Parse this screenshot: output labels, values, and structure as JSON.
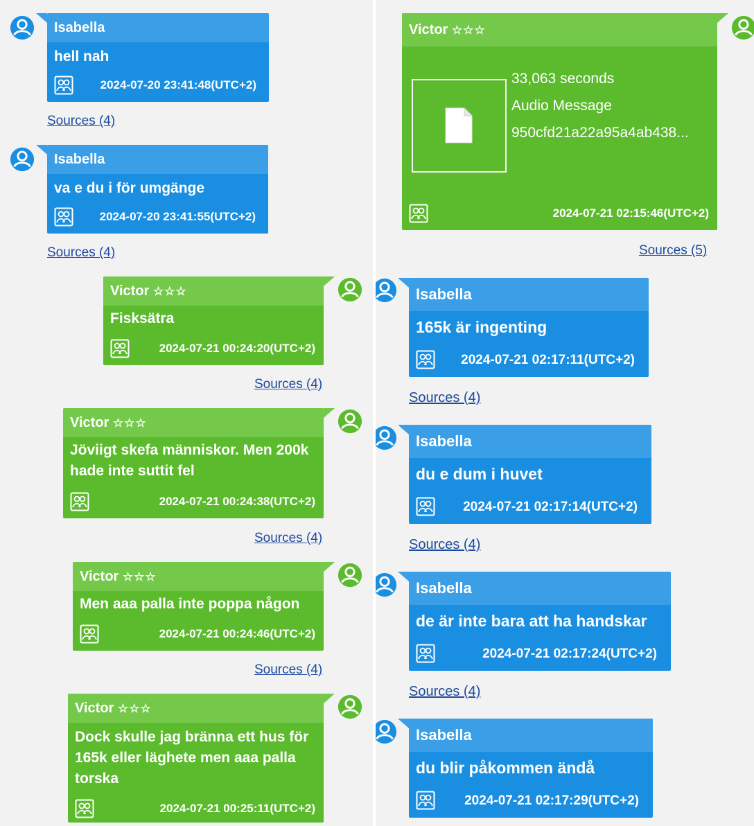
{
  "sources_label": "Sources",
  "colors": {
    "blue": "#1a8fe2",
    "green": "#5bbb2d",
    "link": "#1e4a9e"
  },
  "left_messages": [
    {
      "sender": "Isabella",
      "text": "hell nah",
      "timestamp": "2024-07-20 23:41:48(UTC+2)",
      "sources": "Sources (4)"
    },
    {
      "sender": "Isabella",
      "text": "va e du i för umgänge",
      "timestamp": "2024-07-20 23:41:55(UTC+2)",
      "sources": "Sources (4)"
    },
    {
      "sender": "Victor",
      "stars": "☆☆☆",
      "text": "Fisksätra",
      "timestamp": "2024-07-21 00:24:20(UTC+2)",
      "sources": "Sources (4)"
    },
    {
      "sender": "Victor",
      "stars": "☆☆☆",
      "text": "Jöviigt skefa människor. Men 200k hade inte suttit fel",
      "timestamp": "2024-07-21 00:24:38(UTC+2)",
      "sources": "Sources (4)"
    },
    {
      "sender": "Victor",
      "stars": "☆☆☆",
      "text": "Men aaa palla inte poppa någon",
      "timestamp": "2024-07-21 00:24:46(UTC+2)",
      "sources": "Sources (4)"
    },
    {
      "sender": "Victor",
      "stars": "☆☆☆",
      "text": "Dock skulle jag bränna ett hus för 165k eller läghete men aaa palla torska",
      "timestamp": "2024-07-21 00:25:11(UTC+2)"
    }
  ],
  "right_messages": [
    {
      "sender": "Victor",
      "stars": "☆☆☆",
      "attachment": {
        "duration": "33,063 seconds",
        "type": "Audio Message",
        "hash": "950cfd21a22a95a4ab438..."
      },
      "timestamp": "2024-07-21 02:15:46(UTC+2)",
      "sources": "Sources (5)"
    },
    {
      "sender": "Isabella",
      "text": "165k är ingenting",
      "timestamp": "2024-07-21 02:17:11(UTC+2)",
      "sources": "Sources (4)"
    },
    {
      "sender": "Isabella",
      "text": "du e dum i huvet",
      "timestamp": "2024-07-21 02:17:14(UTC+2)",
      "sources": "Sources (4)"
    },
    {
      "sender": "Isabella",
      "text": "de är inte bara att ha handskar",
      "timestamp": "2024-07-21 02:17:24(UTC+2)",
      "sources": "Sources (4)"
    },
    {
      "sender": "Isabella",
      "text": "du blir påkommen ändå",
      "timestamp": "2024-07-21 02:17:29(UTC+2)"
    }
  ]
}
